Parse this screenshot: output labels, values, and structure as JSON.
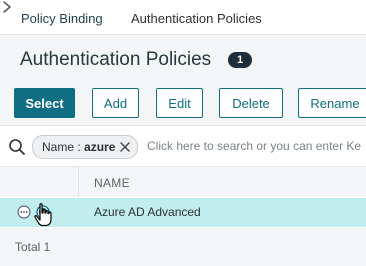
{
  "breadcrumb": {
    "parent": "Policy Binding",
    "current": "Authentication Policies"
  },
  "header": {
    "title": "Authentication Policies",
    "count": "1"
  },
  "toolbar": {
    "select": "Select",
    "add": "Add",
    "edit": "Edit",
    "delete": "Delete",
    "rename": "Rename"
  },
  "search": {
    "filter_key": "Name : ",
    "filter_value": "azure",
    "placeholder": "Click here to search or you can enter Ke"
  },
  "table": {
    "columns": [
      "NAME"
    ],
    "rows": [
      {
        "name": "Azure AD Advanced",
        "selected": true
      }
    ]
  },
  "footer": {
    "total": "Total 1"
  },
  "colors": {
    "accent": "#0f6e82",
    "selected_row": "#c2edee",
    "panel_background": "#f4f5f6",
    "badge": "#1e2d37"
  },
  "icons": {
    "breadcrumb_separator": "chevron-right-icon",
    "search": "search-icon",
    "chip_close": "close-icon",
    "row_menu": "more-options-icon",
    "row_selection": "radio-selected-icon",
    "cursor": "hand-pointer-icon"
  }
}
